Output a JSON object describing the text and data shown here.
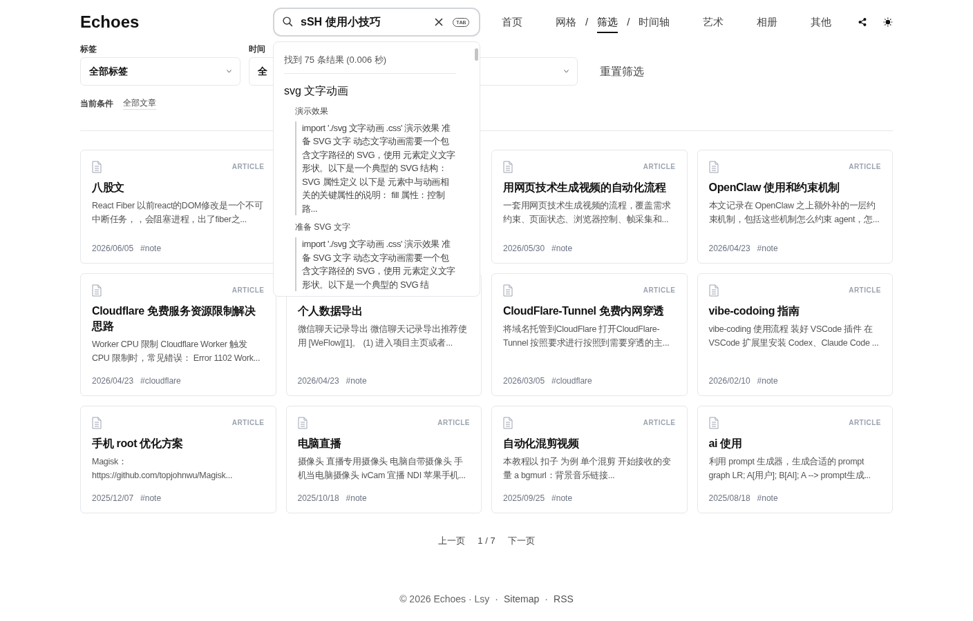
{
  "site_title": "Echoes",
  "search": {
    "value": "sSH 使用小技巧",
    "key_hint": "TAB",
    "results": {
      "summary": "找到 75 条结果 (0.006 秒)",
      "title": "svg 文字动画",
      "sections": [
        {
          "heading": "演示效果",
          "excerpt": "import './svg 文字动画 .css' 演示效果 准备 SVG 文字 动态文字动画需要一个包含文字路径的 SVG，使用 元素定义文字形状。以下是一个典型的 SVG 结构： SVG 属性定义 以下是 元素中与动画相关的关键属性的说明： fill 属性：控制路..."
        },
        {
          "heading": "准备 SVG 文字",
          "excerpt": "import './svg 文字动画 .css' 演示效果 准备 SVG 文字 动态文字动画需要一个包含文字路径的 SVG，使用 元素定义文字形状。以下是一个典型的 SVG 结"
        }
      ]
    }
  },
  "nav": [
    {
      "kind": "link",
      "label": "首页",
      "selected": false
    },
    {
      "kind": "group",
      "items": [
        {
          "kind": "link",
          "label": "网格",
          "selected": false
        },
        {
          "kind": "sep",
          "label": "/"
        },
        {
          "kind": "link",
          "label": "筛选",
          "selected": true
        },
        {
          "kind": "sep",
          "label": "/"
        },
        {
          "kind": "link",
          "label": "时间轴",
          "selected": false
        }
      ]
    },
    {
      "kind": "link",
      "label": "艺术",
      "selected": false
    },
    {
      "kind": "link",
      "label": "相册",
      "selected": false
    },
    {
      "kind": "link",
      "label": "其他",
      "selected": false
    }
  ],
  "filters": [
    {
      "kind": "full",
      "label": "标签",
      "value": "全部标签"
    },
    {
      "kind": "start",
      "label": "时间",
      "value": "全"
    },
    {
      "kind": "chevron_only"
    }
  ],
  "reset_label": "重置筛选",
  "conditions": {
    "label": "当前条件",
    "value": "全部文章"
  },
  "cards": [
    {
      "kind": "full",
      "badge": "ARTICLE",
      "title": "八股文",
      "excerpt": "React Fiber 以前react的DOM修改是一个不可中断任务，，会阻塞进程，出了fiber之...",
      "date": "2026/06/05",
      "tag": "#note"
    },
    {
      "kind": "covered"
    },
    {
      "kind": "full",
      "badge": "ARTICLE",
      "title": "用网页技术生成视频的自动化流程",
      "excerpt": "一套用网页技术生成视频的流程，覆盖需求约束、页面状态、浏览器控制、帧采集和...",
      "date": "2026/05/30",
      "tag": "#note"
    },
    {
      "kind": "full",
      "badge": "ARTICLE",
      "title": "OpenClaw 使用和约束机制",
      "excerpt": "本文记录在 OpenClaw 之上额外补的一层约束机制，包括这些机制怎么约束 agent，怎...",
      "date": "2026/04/23",
      "tag": "#note"
    },
    {
      "kind": "full",
      "badge": "ARTICLE",
      "title": "Cloudflare 免费服务资源限制解决思路",
      "excerpt": "Worker CPU 限制 Cloudflare Worker 触发 CPU 限制时，常见错误： Error 1102 Work...",
      "date": "2026/04/23",
      "tag": "#cloudflare"
    },
    {
      "kind": "lower",
      "title": "个人数据导出",
      "excerpt": "微信聊天记录导出 微信聊天记录导出推荐使用 [WeFlow][1]。 (1) 进入项目主页或者...",
      "date": "2026/04/23",
      "tag": "#note"
    },
    {
      "kind": "full",
      "badge": "ARTICLE",
      "title": "CloudFlare-Tunnel 免费内网穿透",
      "excerpt": "将域名托管到CloudFlare 打开CloudFlare-Tunnel 按照要求进行按照到需要穿透的主...",
      "date": "2026/03/05",
      "tag": "#cloudflare"
    },
    {
      "kind": "full",
      "badge": "ARTICLE",
      "title": "vibe-codoing 指南",
      "excerpt": "vibe-coding 使用流程 装好 VSCode 插件 在 VSCode 扩展里安装 Codex、Claude Code ...",
      "date": "2026/02/10",
      "tag": "#note"
    },
    {
      "kind": "full",
      "badge": "ARTICLE",
      "title": "手机 root 优化方案",
      "excerpt": "Magisk： https://github.com/topjohnwu/Magisk...",
      "date": "2025/12/07",
      "tag": "#note"
    },
    {
      "kind": "full",
      "badge": "ARTICLE",
      "title": "电脑直播",
      "excerpt": "摄像头 直播专用摄像头 电脑自带摄像头 手机当电脑摄像头 ivCam 宜播 NDI 苹果手机...",
      "date": "2025/10/18",
      "tag": "#note"
    },
    {
      "kind": "full",
      "badge": "ARTICLE",
      "title": "自动化混剪视频",
      "excerpt": "本教程以 扣子 为例 单个混剪 开始接收的变量 a bgmurl：背景音乐链接...",
      "date": "2025/09/25",
      "tag": "#note"
    },
    {
      "kind": "full",
      "badge": "ARTICLE",
      "title": "ai 使用",
      "excerpt": "利用 prompt 生成器，生成合适的 prompt graph LR; A[用户]; B[AI]; A --> prompt生成...",
      "date": "2025/08/18",
      "tag": "#note"
    }
  ],
  "pagination": {
    "prev": "上一页",
    "page": "1 / 7",
    "next": "下一页"
  },
  "footer": [
    {
      "kind": "text",
      "label": "© 2026 Echoes · Lsy"
    },
    {
      "kind": "sep",
      "label": "·"
    },
    {
      "kind": "link",
      "label": "Sitemap"
    },
    {
      "kind": "sep",
      "label": "·"
    },
    {
      "kind": "link",
      "label": "RSS"
    }
  ]
}
